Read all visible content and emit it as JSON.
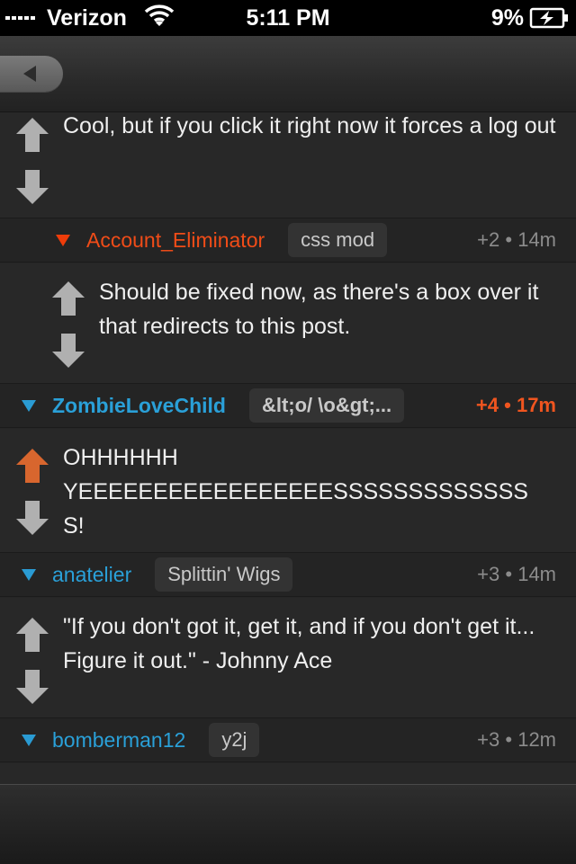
{
  "status_bar": {
    "carrier": "Verizon",
    "time": "5:11 PM",
    "battery": "9%"
  },
  "comments": [
    {
      "body": "Cool, but if you click it right now it forces a log out",
      "vote_state": "none"
    },
    {
      "author": "Account_Eliminator",
      "flair": "css mod",
      "score": "+2",
      "age": "14m",
      "author_color": "#f04c18",
      "body": "Should be fixed now, as there's a box over it that redirects to this post.",
      "vote_state": "none"
    },
    {
      "author": "ZombieLoveChild",
      "flair": "&lt;o/ \\o&gt;...",
      "score": "+4",
      "age": "17m",
      "author_color": "#2aa0d8",
      "body_lines": [
        "OHHHHHH",
        "YEEEEEEEEEEEEEEEEESSSSSSSSSSSSS",
        "S!"
      ],
      "vote_state": "upvoted"
    },
    {
      "author": "anatelier",
      "flair": "Splittin' Wigs",
      "score": "+3",
      "age": "14m",
      "author_color": "#2aa0d8",
      "body": "\"If you don't got it, get it, and if you don't get it... Figure it out.\" - Johnny Ace",
      "vote_state": "none"
    },
    {
      "author": "bomberman12",
      "flair": "y2j",
      "score": "+3",
      "age": "12m",
      "author_color": "#2aa0d8"
    }
  ],
  "colors": {
    "upvote_active": "#d8662e",
    "vote_inactive": "#b0b0b0"
  },
  "separator": "•"
}
